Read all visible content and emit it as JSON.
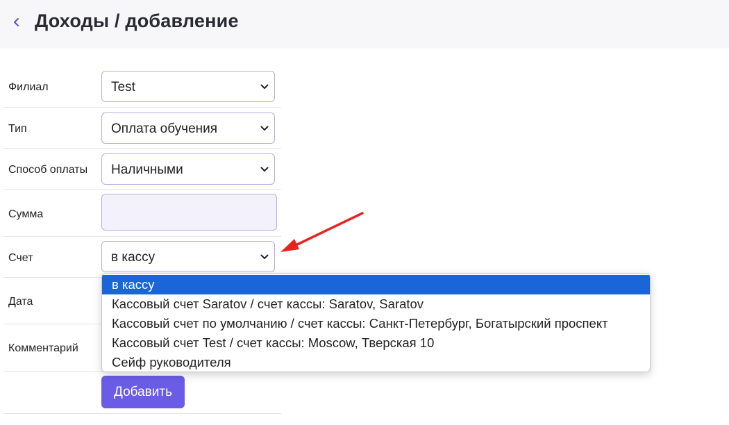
{
  "header": {
    "title": "Доходы / добавление",
    "back_icon": "chevron-left-icon"
  },
  "form": {
    "branch": {
      "label": "Филиал",
      "value": "Test"
    },
    "type": {
      "label": "Тип",
      "value": "Оплата обучения"
    },
    "payment_method": {
      "label": "Способ оплаты",
      "value": "Наличными"
    },
    "amount": {
      "label": "Сумма",
      "value": ""
    },
    "account": {
      "label": "Счет",
      "value": "в кассу"
    },
    "date": {
      "label": "Дата"
    },
    "comment": {
      "label": "Комментарий"
    },
    "submit_label": "Добавить"
  },
  "account_dropdown": {
    "options": [
      "в кассу",
      "Кассовый счет Saratov / счет кассы: Saratov, Saratov",
      "Кассовый счет по умолчанию / счет кассы: Санкт-Петербург, Богатырский проспект",
      "Кассовый счет Test / счет кассы: Moscow, Тверская 10",
      "Сейф руководителя"
    ],
    "selected": "в кассу"
  },
  "colors": {
    "accent": "#6a5ce6",
    "field_border": "#b6ace6",
    "selected_option": "#1a66d8",
    "annotation_arrow": "#e8231f"
  }
}
